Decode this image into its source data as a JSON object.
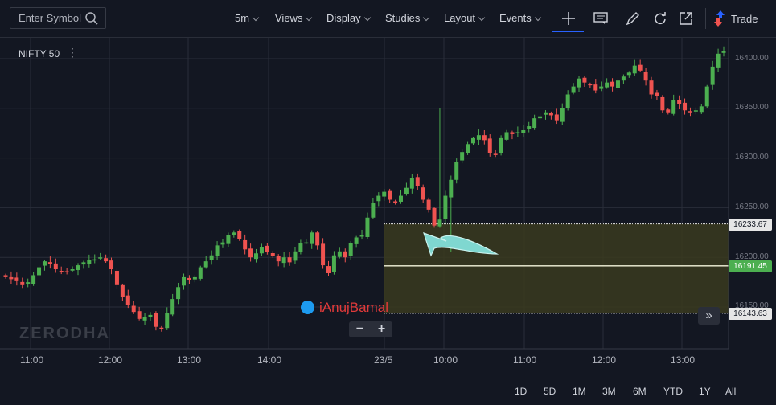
{
  "toolbar": {
    "search_placeholder": "Enter Symbol",
    "interval": "5m",
    "views": "Views",
    "display": "Display",
    "studies": "Studies",
    "layout": "Layout",
    "events": "Events",
    "trade": "Trade"
  },
  "symbol": {
    "name": "NIFTY 50"
  },
  "price_axis": {
    "ticks": [
      "16400.00",
      "16350.00",
      "16300.00",
      "16250.00",
      "16200.00",
      "16150.00"
    ],
    "tags": [
      {
        "label": "16233.67",
        "value": 16233.67,
        "style": "light"
      },
      {
        "label": "16191.45",
        "value": 16191.45,
        "style": "green"
      },
      {
        "label": "16143.63",
        "value": 16143.63,
        "style": "light"
      }
    ]
  },
  "time_axis": [
    "11:00",
    "12:00",
    "13:00",
    "14:00",
    "23/5",
    "10:00",
    "11:00",
    "12:00",
    "13:00"
  ],
  "zoom": {
    "minus": "−",
    "plus": "+"
  },
  "watermark": {
    "text": "iAnujBamal",
    "logo": "ZERODHA"
  },
  "ranges": [
    "1D",
    "5D",
    "1M",
    "3M",
    "6M",
    "YTD",
    "1Y",
    "All"
  ],
  "colors": {
    "up": "#4caf50",
    "down": "#ef5350",
    "zone": "#3a3a1f",
    "accent": "#2962ff",
    "arrow": "#7fd7d0"
  },
  "chart_data": {
    "type": "candlestick",
    "symbol": "NIFTY 50",
    "interval": "5m",
    "x": [
      "11:00",
      "12:00",
      "13:00",
      "14:00",
      "23/5",
      "10:00",
      "11:00",
      "12:00",
      "13:00"
    ],
    "ylim": [
      16120,
      16420
    ],
    "levels": [
      16233.67,
      16191.45,
      16143.63
    ],
    "zone": [
      16143.63,
      16233.67
    ],
    "closes": [
      16180,
      16178,
      16176,
      16172,
      16175,
      16182,
      16190,
      16196,
      16193,
      16188,
      16186,
      16185,
      16188,
      16192,
      16195,
      16197,
      16198,
      16200,
      16196,
      16188,
      16172,
      16160,
      16152,
      16145,
      16138,
      16140,
      16142,
      16130,
      16128,
      16144,
      16158,
      16170,
      16180,
      16177,
      16180,
      16190,
      16196,
      16202,
      16212,
      16215,
      16222,
      16225,
      16218,
      16208,
      16200,
      16204,
      16210,
      16205,
      16201,
      16196,
      16200,
      16195,
      16206,
      16214,
      16215,
      16225,
      16212,
      16192,
      16184,
      16202,
      16206,
      16200,
      16214,
      16220,
      16222,
      16240,
      16255,
      16262,
      16266,
      16258,
      16256,
      16262,
      16270,
      16280,
      16272,
      16258,
      16248,
      16232,
      16238,
      16262,
      16278,
      16296,
      16306,
      16314,
      16320,
      16323,
      16318,
      16305,
      16304,
      16320,
      16326,
      16324,
      16326,
      16328,
      16332,
      16340,
      16342,
      16346,
      16343,
      16338,
      16350,
      16364,
      16372,
      16380,
      16376,
      16374,
      16368,
      16372,
      16376,
      16372,
      16378,
      16382,
      16386,
      16393,
      16388,
      16378,
      16364,
      16362,
      16348,
      16346,
      16358,
      16354,
      16348,
      16346,
      16348,
      16352,
      16372,
      16392,
      16405,
      16408
    ]
  }
}
